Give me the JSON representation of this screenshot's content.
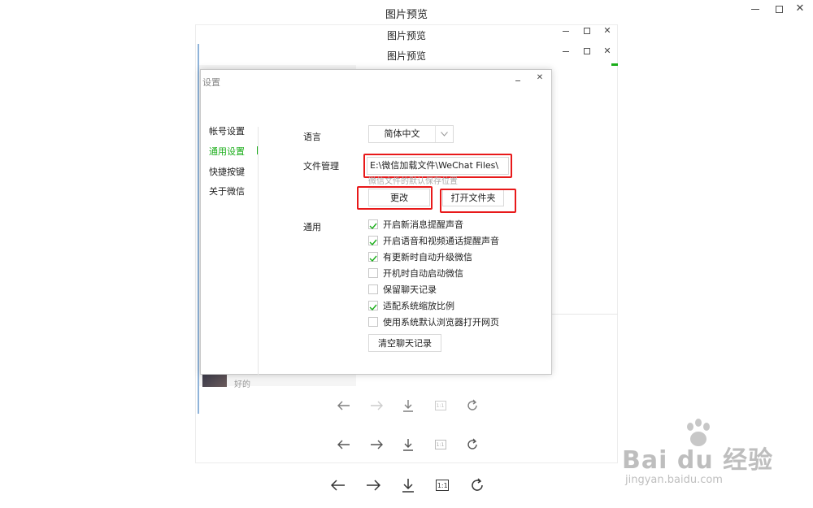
{
  "outer_window": {
    "title": "图片预览"
  },
  "mid_window": {
    "title": "图片预览"
  },
  "inner_window": {
    "title": "图片预览"
  },
  "chat_preview": {
    "snippet": "好的"
  },
  "settings": {
    "title": "设置",
    "nav": [
      {
        "label": "帐号设置"
      },
      {
        "label": "通用设置"
      },
      {
        "label": "快捷按键"
      },
      {
        "label": "关于微信"
      }
    ],
    "language_label": "语言",
    "language_value": "简体中文",
    "file_mgmt_label": "文件管理",
    "file_path": "E:\\微信加载文件\\WeChat Files\\",
    "file_path_hint": "微信文件的默认保存位置",
    "change_button": "更改",
    "open_folder_button": "打开文件夹",
    "general_label": "通用",
    "options": [
      {
        "label": "开启新消息提醒声音",
        "checked": true
      },
      {
        "label": "开启语音和视频通话提醒声音",
        "checked": true
      },
      {
        "label": "有更新时自动升级微信",
        "checked": true
      },
      {
        "label": "开机时自动启动微信",
        "checked": false
      },
      {
        "label": "保留聊天记录",
        "checked": false
      },
      {
        "label": "适配系统缩放比例",
        "checked": true
      },
      {
        "label": "使用系统默认浏览器打开网页",
        "checked": false
      }
    ],
    "clear_history_button": "清空聊天记录"
  },
  "toolbar": {
    "actual_size_label": "1:1"
  },
  "watermark": {
    "brand": "Bai du 经验",
    "url": "jingyan.baidu.com"
  },
  "colors": {
    "accent": "#1aad19",
    "highlight": "#e8191a"
  }
}
